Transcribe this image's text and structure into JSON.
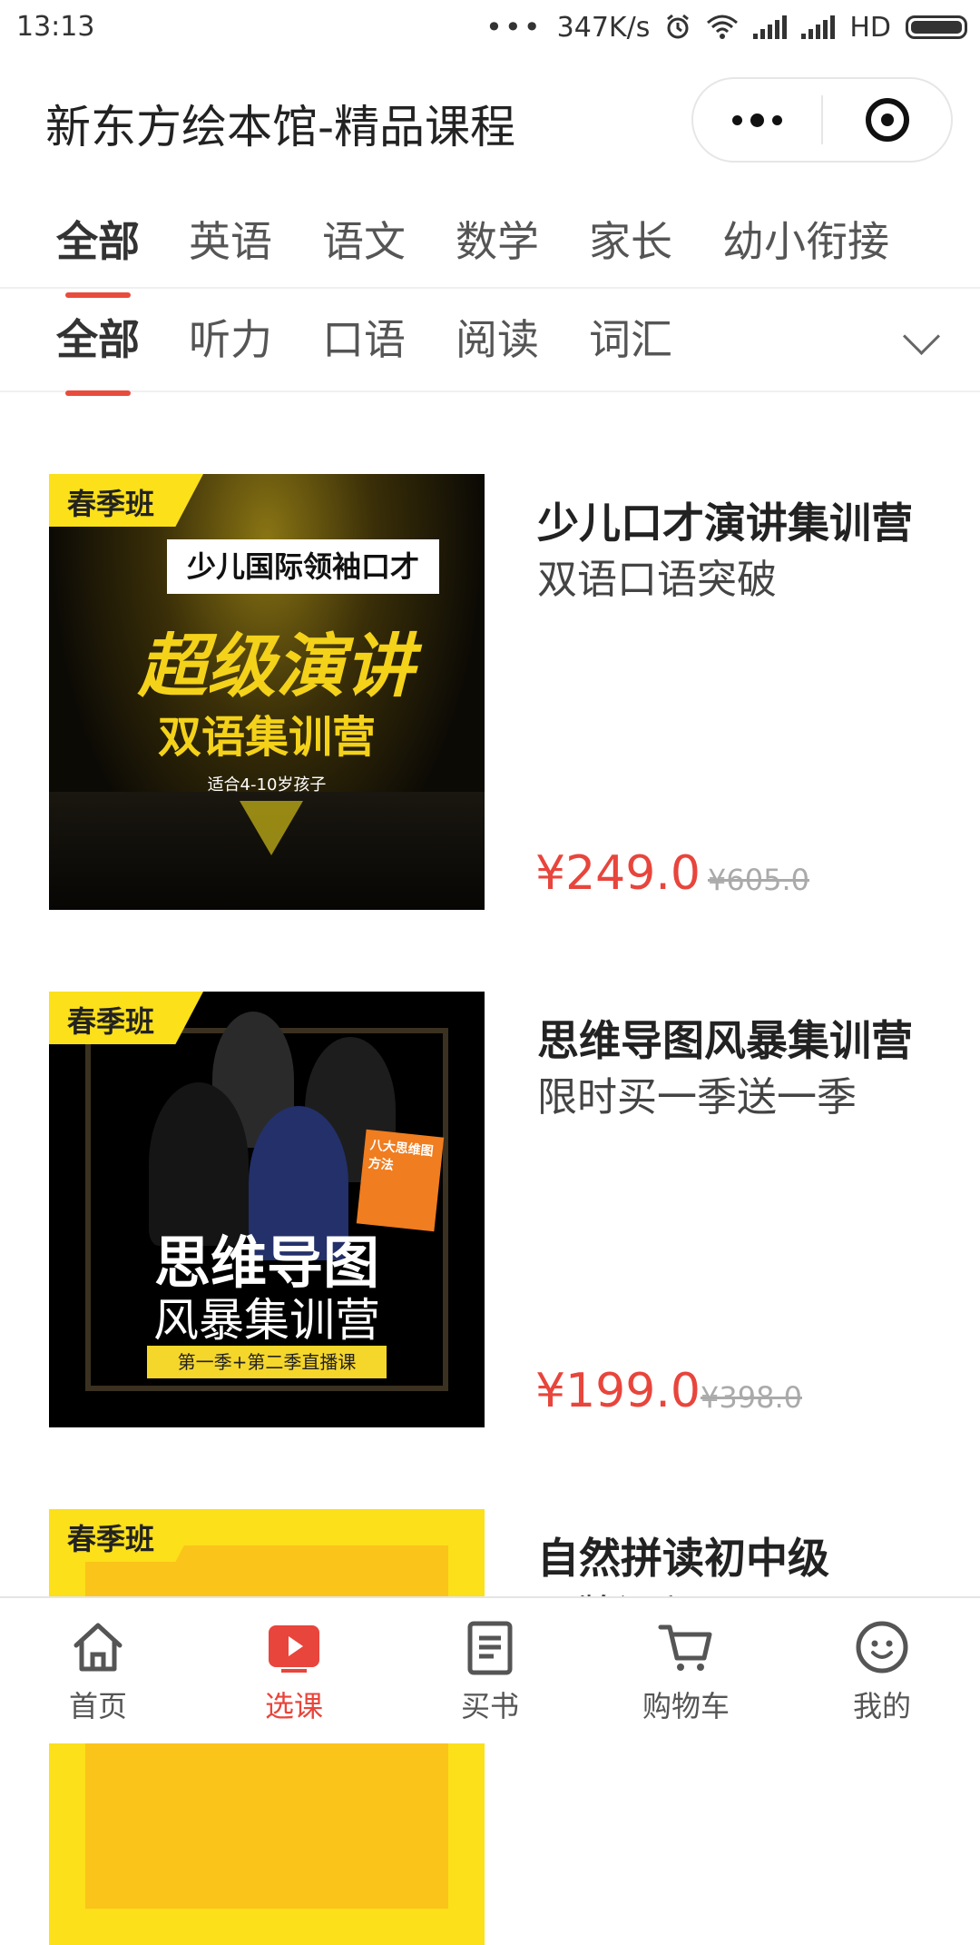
{
  "status_bar": {
    "time": "13:13",
    "dots": "•••",
    "net_speed": "347K/s",
    "hd": "HD",
    "icons": [
      "alarm-icon",
      "wifi-icon",
      "signal-icon",
      "signal-icon",
      "battery-icon"
    ]
  },
  "header": {
    "title": "新东方绘本馆-精品课程",
    "more_icon": "more-dots-icon",
    "close_icon": "target-icon"
  },
  "primary_tabs": [
    "全部",
    "英语",
    "语文",
    "数学",
    "家长",
    "幼小衔接"
  ],
  "primary_active": 0,
  "secondary_tabs": [
    "全部",
    "听力",
    "口语",
    "阅读",
    "词汇"
  ],
  "secondary_active": 0,
  "colors": {
    "accent": "#e84c3d",
    "price": "#e8453c",
    "badge": "#fbe01a"
  },
  "courses": [
    {
      "badge": "春季班",
      "title": "少儿口才演讲集训营",
      "subtitle": "双语口语突破",
      "price": "¥249.0",
      "original_price": "¥605.0",
      "thumb": {
        "banner": "少儿国际领袖口才",
        "headline": "超级演讲",
        "subhead": "双语集训营",
        "caption": "适合4-10岁孩子"
      }
    },
    {
      "badge": "春季班",
      "title": "思维导图风暴集训营",
      "subtitle": "限时买一季送一季",
      "price": "¥199.0",
      "original_price": "¥398.0",
      "thumb": {
        "headline": "思维导图",
        "subhead": "风暴集训营",
        "strip": "第一季+第二季直播课",
        "book": "八大思维图方法"
      }
    },
    {
      "badge": "春季班",
      "title": "自然拼读初中级",
      "subtitle": "王牌课程"
    }
  ],
  "bottom_nav": [
    {
      "label": "首页",
      "icon": "home-icon"
    },
    {
      "label": "选课",
      "icon": "play-icon"
    },
    {
      "label": "买书",
      "icon": "book-icon"
    },
    {
      "label": "购物车",
      "icon": "cart-icon"
    },
    {
      "label": "我的",
      "icon": "smiley-icon"
    }
  ],
  "bottom_nav_active": 1
}
